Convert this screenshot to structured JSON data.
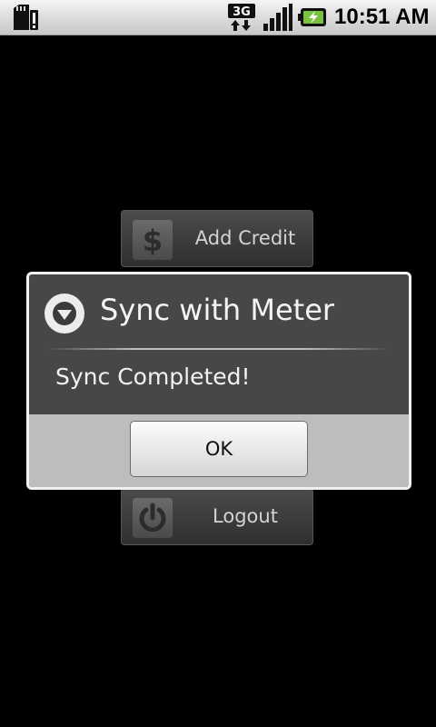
{
  "status_bar": {
    "time": "10:51 AM",
    "network_type": "3G",
    "icons": [
      "sd-card-warning-icon",
      "network-3g-icon",
      "signal-strength-icon",
      "battery-charging-icon"
    ]
  },
  "menu": {
    "add_credit_label": "Add Credit",
    "add_credit_icon": "dollar-icon",
    "logout_label": "Logout",
    "logout_icon": "power-icon"
  },
  "dialog": {
    "title": "Sync with Meter",
    "title_icon": "chevron-down-circle-icon",
    "message": "Sync Completed!",
    "ok_label": "OK"
  },
  "colors": {
    "background": "#000000",
    "dialog_body": "#474747",
    "dialog_footer": "#bdbdbd",
    "dialog_border": "#f2f2f2",
    "battery_charge": "#7bc142"
  }
}
